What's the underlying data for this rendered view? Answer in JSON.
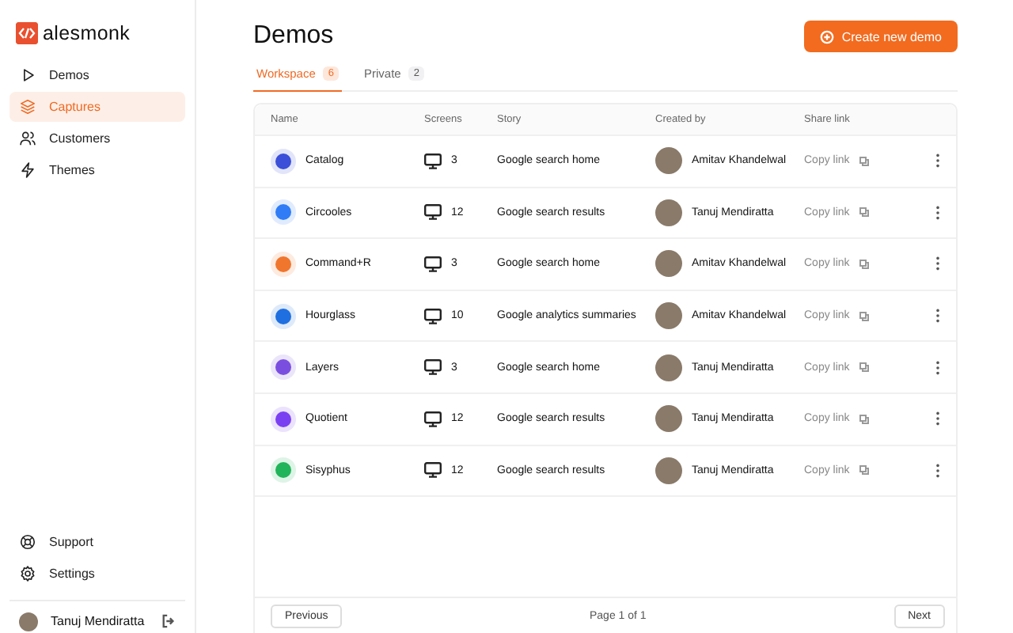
{
  "brand": {
    "name": "alesmonk"
  },
  "sidebar": {
    "items": [
      {
        "label": "Demos",
        "selected": false
      },
      {
        "label": "Captures",
        "selected": true
      },
      {
        "label": "Customers",
        "selected": false
      },
      {
        "label": "Themes",
        "selected": false
      }
    ],
    "bottom_items": [
      {
        "label": "Support"
      },
      {
        "label": "Settings"
      }
    ],
    "user": {
      "name": "Tanuj Mendiratta"
    }
  },
  "page": {
    "title": "Demos",
    "primary_button": "Create new demo"
  },
  "tabs": [
    {
      "label": "Workspace",
      "count": "6",
      "selected": true
    },
    {
      "label": "Private",
      "count": "2",
      "selected": false
    }
  ],
  "table": {
    "columns": [
      "Name",
      "Screens",
      "Story",
      "Created by",
      "Share link"
    ],
    "rows": [
      {
        "name": "Catalog",
        "color": "#3b4fd8",
        "screens": "3",
        "story": "Google search home",
        "creator": "Amitav Khandelwal",
        "share": "Copy link"
      },
      {
        "name": "Circooles",
        "color": "#2f7cf6",
        "screens": "12",
        "story": "Google search results",
        "creator": "Tanuj Mendiratta",
        "share": "Copy link"
      },
      {
        "name": "Command+R",
        "color": "#f0762e",
        "screens": "3",
        "story": "Google search home",
        "creator": "Amitav Khandelwal",
        "share": "Copy link"
      },
      {
        "name": "Hourglass",
        "color": "#1f6fe0",
        "screens": "10",
        "story": "Google analytics summaries",
        "creator": "Amitav Khandelwal",
        "share": "Copy link"
      },
      {
        "name": "Layers",
        "color": "#7a4fe0",
        "screens": "3",
        "story": "Google search home",
        "creator": "Tanuj Mendiratta",
        "share": "Copy link"
      },
      {
        "name": "Quotient",
        "color": "#7b3ff2",
        "screens": "12",
        "story": "Google search results",
        "creator": "Tanuj Mendiratta",
        "share": "Copy link"
      },
      {
        "name": "Sisyphus",
        "color": "#22b45a",
        "screens": "12",
        "story": "Google search results",
        "creator": "Tanuj Mendiratta",
        "share": "Copy link"
      }
    ]
  },
  "pagination": {
    "previous": "Previous",
    "status": "Page 1 of 1",
    "next": "Next"
  }
}
